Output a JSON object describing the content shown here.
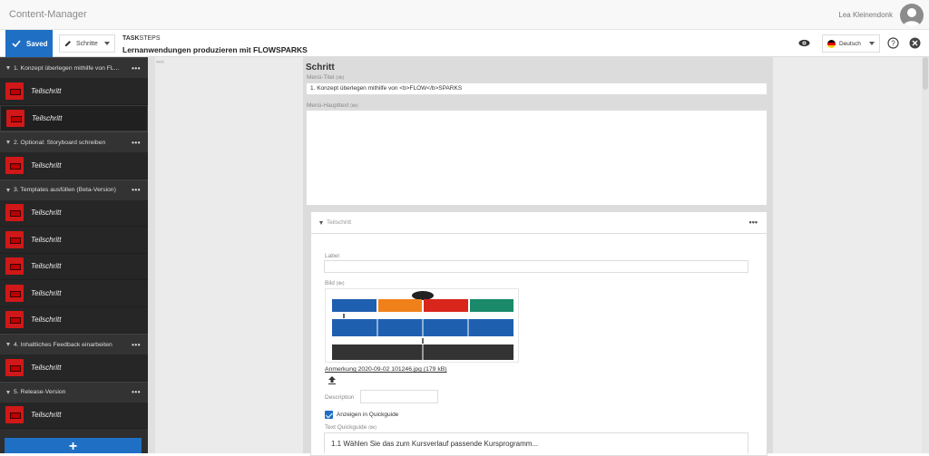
{
  "app": {
    "title": "Content-Manager",
    "user": "Lea Kleinendonk"
  },
  "toolbar": {
    "saved_label": "Saved",
    "steps_label": "Schritte",
    "breadcrumb_prefix": "TASK",
    "breadcrumb_suffix": "STEPS",
    "title": "Lernanwendungen produzieren mit FLOWSPARKS",
    "language": "Deutsch"
  },
  "sidebar": {
    "sections": [
      {
        "label": "1. Konzept überlegen mithilfe von FL...",
        "items": [
          "Teilschritt",
          "Teilschritt"
        ]
      },
      {
        "label": "2. Optional: Storyboard schreiben",
        "items": [
          "Teilschritt"
        ]
      },
      {
        "label": "3. Templates ausfüllen (Beta-Version)",
        "items": [
          "Teilschritt",
          "Teilschritt",
          "Teilschritt",
          "Teilschritt",
          "Teilschritt"
        ]
      },
      {
        "label": "4. Inhaltliches Feedback einarbeiten",
        "items": [
          "Teilschritt"
        ]
      },
      {
        "label": "5. Release-Version",
        "items": [
          "Teilschritt"
        ]
      }
    ],
    "more_label": "•••",
    "add_label": "+"
  },
  "collapse_label": "<<<",
  "form": {
    "heading": "Schritt",
    "menu_title_label": "Menü-Titel",
    "de_tag": "(de)",
    "menu_title_value": "1. Konzept überlegen mithilfe von <b>FLOW</b>SPARKS",
    "menu_subtitle_label": "Menü-Haupttext",
    "card": {
      "title": "Teilschritt",
      "label_label": "Label",
      "image_label": "Bild",
      "file_name": "Anmerkung 2020-09-02 101246.jpg (179 kB)",
      "description_label": "Description",
      "quickguide_checkbox": "Anzeigen in Quickguide",
      "quickguide_text_label": "Text Quickguide",
      "quickguide_text_value": "1.1 Wählen Sie das zum Kursverlauf passende Kursprogramm..."
    }
  },
  "colors": {
    "accent": "#1f6fc5",
    "sidebar_bg": "#2e2e2e",
    "item_icon": "#d01818"
  }
}
